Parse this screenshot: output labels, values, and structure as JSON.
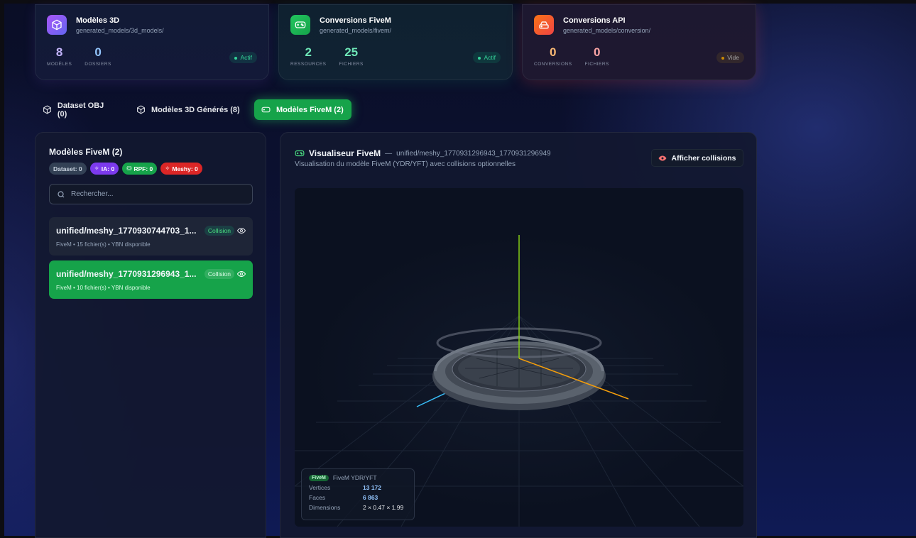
{
  "stats": [
    {
      "title": "Modèles 3D",
      "path": "generated_models/3d_models/",
      "n1": "8",
      "l1": "MODÈLES",
      "n2": "0",
      "l2": "DOSSIERS",
      "status": "Actif",
      "icon": "cube-icon"
    },
    {
      "title": "Conversions FiveM",
      "path": "generated_models/fivem/",
      "n1": "2",
      "l1": "RESSOURCES",
      "n2": "25",
      "l2": "FICHIERS",
      "status": "Actif",
      "icon": "gamepad-icon"
    },
    {
      "title": "Conversions API",
      "path": "generated_models/conversion/",
      "n1": "0",
      "l1": "CONVERSIONS",
      "n2": "0",
      "l2": "FICHIERS",
      "status": "Vide",
      "icon": "server-icon"
    }
  ],
  "tabs": [
    {
      "label": "Dataset OBJ (0)"
    },
    {
      "label": "Modèles 3D Générés (8)"
    },
    {
      "label": "Modèles FiveM (2)",
      "active": true
    }
  ],
  "list_panel": {
    "title": "Modèles FiveM (2)",
    "chips": [
      "Dataset: 0",
      "IA: 0",
      "RPF: 0",
      "Meshy: 0"
    ],
    "search_placeholder": "Rechercher...",
    "items": [
      {
        "name": "unified/meshy_1770930744703_1...",
        "sub": "FiveM • 15 fichier(s) • YBN disponible",
        "badge": "Collision",
        "selected": false
      },
      {
        "name": "unified/meshy_1770931296943_1...",
        "sub": "FiveM • 10 fichier(s) • YBN disponible",
        "badge": "Collision",
        "selected": true
      }
    ]
  },
  "viewer": {
    "title": "Visualiseur FiveM",
    "separator": "—",
    "model": "unified/meshy_1770931296943_1770931296949",
    "description": "Visualisation du modèle FiveM (YDR/YFT) avec collisions optionnelles",
    "collision_button": "Afficher collisions",
    "info": {
      "tag": "FiveM",
      "format": "FiveM YDR/YFT",
      "vertices_label": "Vertices",
      "vertices": "13 172",
      "faces_label": "Faces",
      "faces": "6 863",
      "dimensions_label": "Dimensions",
      "dimensions": "2 × 0.47 × 1.99"
    }
  },
  "colors": {
    "accent_green": "#16a34a",
    "purple": "#7c3aed",
    "red": "#dc2626",
    "axis_x": "#f59e0b",
    "axis_y": "#84cc16",
    "axis_z": "#38bdf8"
  }
}
